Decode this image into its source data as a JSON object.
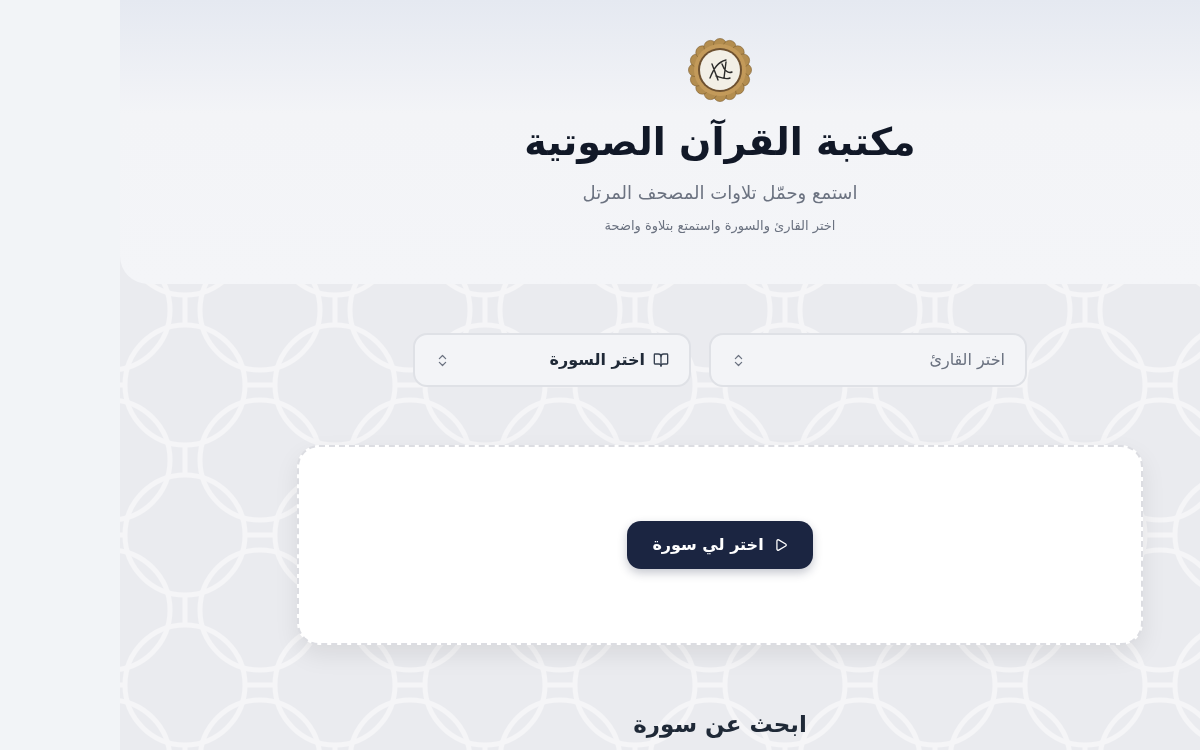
{
  "header": {
    "title": "مكتبة القرآن الصوتية",
    "subtitle": "استمع وحمّل تلاوات المصحف المرتل",
    "hint": "اختر القارئ والسورة واستمتع بتلاوة واضحة"
  },
  "selects": [
    {
      "kind": "dropdown",
      "placeholder": "اختر القارئ"
    },
    {
      "kind": "picker",
      "label": "اختر السورة"
    }
  ],
  "random_card": {
    "button": "اختر لي سورة"
  },
  "search": {
    "title": "ابحث عن سورة"
  }
}
